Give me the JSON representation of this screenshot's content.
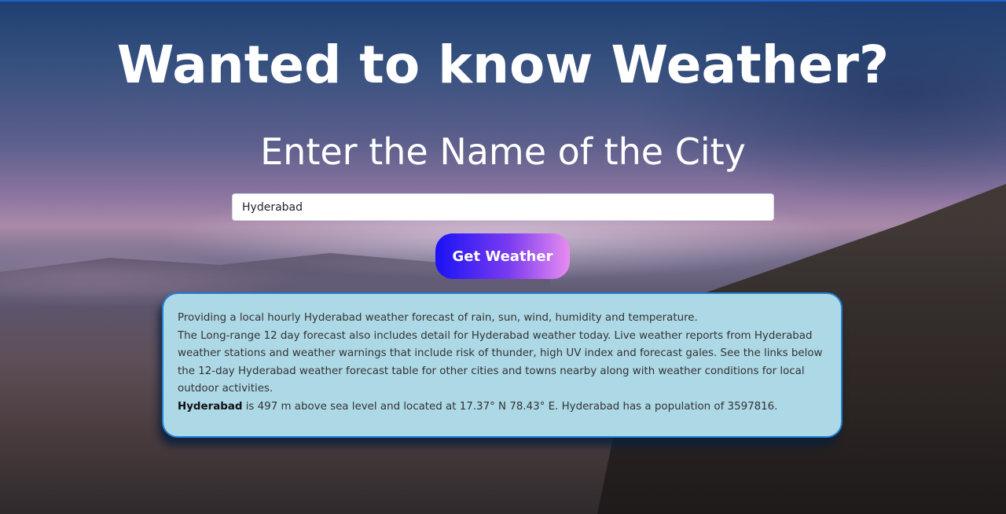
{
  "header": {
    "title": "Wanted to know Weather?",
    "subtitle": "Enter the Name of the City"
  },
  "search": {
    "value": "Hyderabad"
  },
  "button": {
    "label": "Get Weather"
  },
  "info": {
    "line1": "Providing a local hourly Hyderabad weather forecast of rain, sun, wind, humidity and temperature.",
    "line2": "The Long-range 12 day forecast also includes detail for Hyderabad weather today. Live weather reports from Hyderabad weather stations and weather warnings that include risk of thunder, high UV index and forecast gales. See the links below the 12-day Hyderabad weather forecast table for other cities and towns nearby along with weather conditions for local outdoor activities.",
    "city_bold": "Hyderabad",
    "line3_rest": " is 497 m above sea level and located at 17.37° N 78.43° E. Hyderabad has a population of 3597816."
  },
  "colors": {
    "info_bg": "#add8e6",
    "info_border": "#1f7fd0",
    "button_gradient_start": "#1a12f5",
    "button_gradient_end": "#e88cf0"
  }
}
